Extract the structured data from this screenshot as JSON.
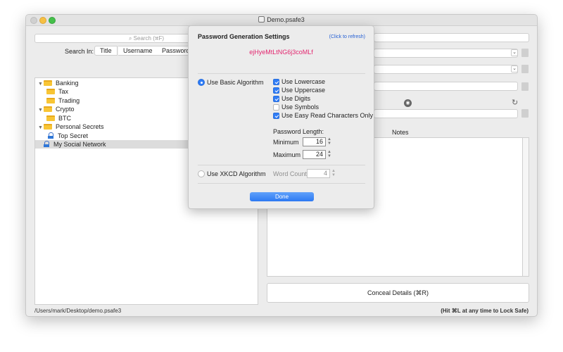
{
  "window": {
    "title": "Demo.psafe3"
  },
  "search": {
    "placeholder": "Search (⌘F)"
  },
  "search_in": {
    "label": "Search In:",
    "options": [
      "Title",
      "Username",
      "Password"
    ]
  },
  "tree": {
    "items": [
      {
        "label": "Banking",
        "type": "group",
        "expanded": true
      },
      {
        "label": "Tax",
        "type": "group"
      },
      {
        "label": "Trading",
        "type": "group"
      },
      {
        "label": "Crypto",
        "type": "group",
        "expanded": true
      },
      {
        "label": "BTC",
        "type": "group"
      },
      {
        "label": "Personal Secrets",
        "type": "group",
        "expanded": true
      },
      {
        "label": "Top Secret",
        "type": "record"
      },
      {
        "label": "My Social Network",
        "type": "record",
        "selected": true
      }
    ]
  },
  "details": {
    "notes_label": "Notes",
    "conceal_button": "Conceal Details (⌘R)"
  },
  "status": {
    "path": "/Users/mark/Desktop/demo.psafe3",
    "hint": "(Hit ⌘L at any time to Lock Safe)"
  },
  "password_generator": {
    "title": "Password Generation Settings",
    "refresh_link": "(Click to refresh)",
    "generated_password": "ejHyeMtLtNG6j3coMLf",
    "basic_algorithm_label": "Use Basic Algorithm",
    "basic_algorithm_selected": true,
    "options": [
      {
        "label": "Use Lowercase",
        "checked": true
      },
      {
        "label": "Use Uppercase",
        "checked": true
      },
      {
        "label": "Use Digits",
        "checked": true
      },
      {
        "label": "Use Symbols",
        "checked": false
      },
      {
        "label": "Use Easy Read Characters Only",
        "checked": true
      }
    ],
    "length_label": "Password Length:",
    "minimum_label": "Minimum",
    "minimum_value": "16",
    "maximum_label": "Maximum",
    "maximum_value": "24",
    "xkcd_label": "Use XKCD Algorithm",
    "xkcd_selected": false,
    "word_count_label": "Word Count",
    "word_count_value": "4",
    "done_button": "Done"
  },
  "colors": {
    "accent": "#2f7cf6",
    "password_text": "#e3266f",
    "folder": "#f8c535",
    "link": "#2761d4"
  },
  "icons": [
    "search-icon",
    "folder-icon",
    "record-icon",
    "lock-icon",
    "refresh-icon",
    "chevron-down-icon",
    "copy-icon"
  ]
}
